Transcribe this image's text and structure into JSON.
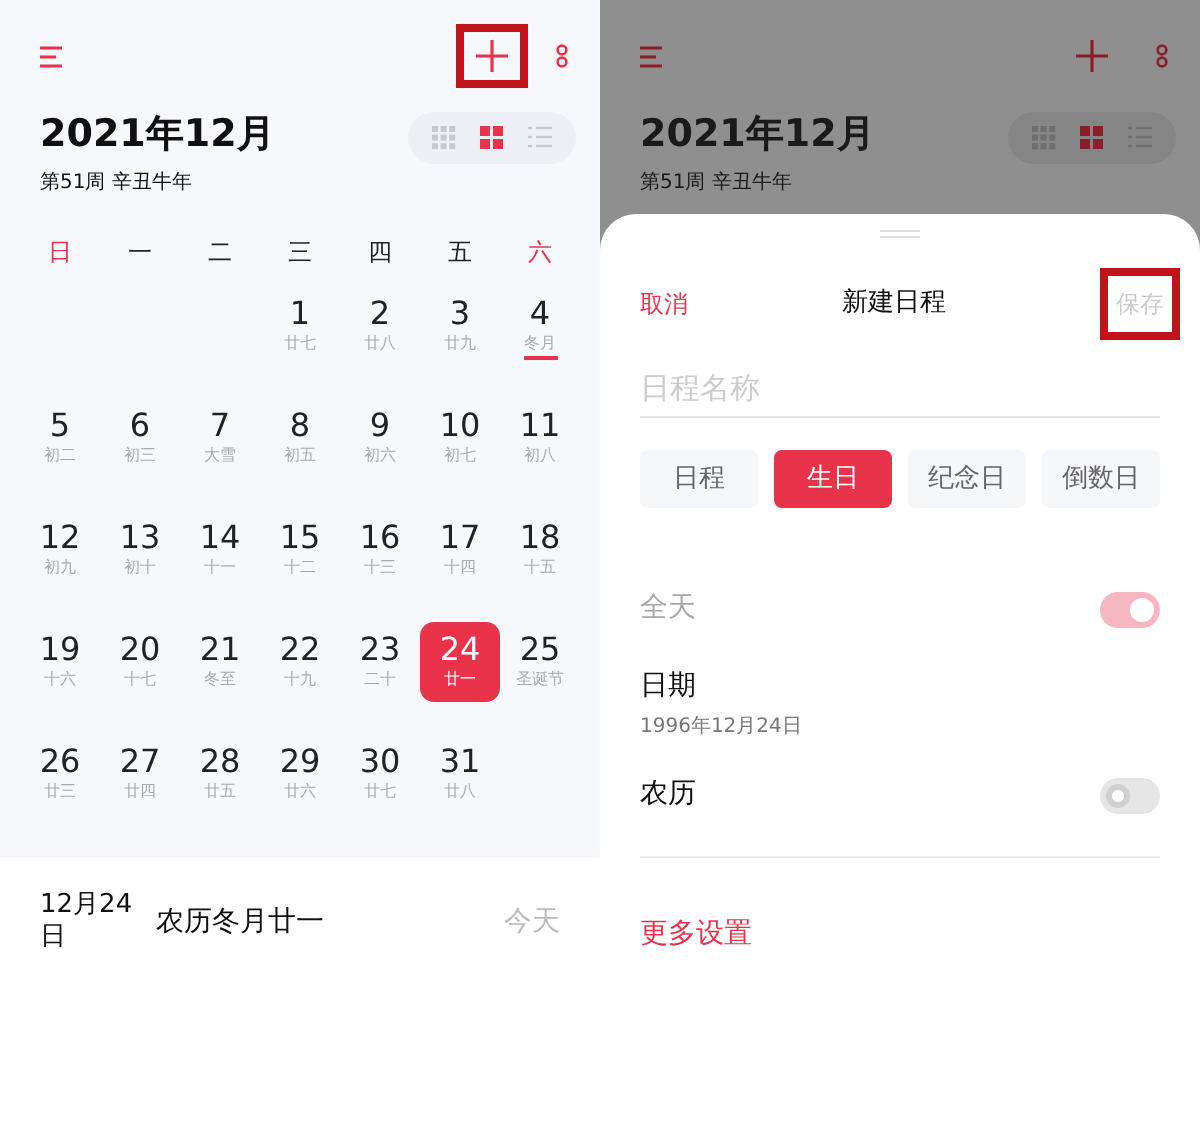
{
  "calendar": {
    "header": {
      "add_highlighted": true
    },
    "title": "2021年12月",
    "subtitle": "第51周 辛丑牛年",
    "view_modes": [
      {
        "kind": "grid9",
        "selected": false
      },
      {
        "kind": "grid4",
        "selected": true
      },
      {
        "kind": "list",
        "selected": false
      }
    ],
    "weekdays": [
      {
        "label": "日",
        "weekend": true
      },
      {
        "label": "一",
        "weekend": false
      },
      {
        "label": "二",
        "weekend": false
      },
      {
        "label": "三",
        "weekend": false
      },
      {
        "label": "四",
        "weekend": false
      },
      {
        "label": "五",
        "weekend": false
      },
      {
        "label": "六",
        "weekend": true
      }
    ],
    "weeks": [
      [
        {
          "day": "1",
          "lunar": "廿七",
          "selected": false,
          "marked": false
        },
        {
          "day": "2",
          "lunar": "廿八",
          "selected": false,
          "marked": false
        },
        {
          "day": "3",
          "lunar": "廿九",
          "selected": false,
          "marked": false
        },
        {
          "day": "4",
          "lunar": "冬月",
          "selected": false,
          "marked": true
        }
      ],
      [
        {
          "day": "5",
          "lunar": "初二",
          "selected": false,
          "marked": false
        },
        {
          "day": "6",
          "lunar": "初三",
          "selected": false,
          "marked": false
        },
        {
          "day": "7",
          "lunar": "大雪",
          "selected": false,
          "marked": false
        },
        {
          "day": "8",
          "lunar": "初五",
          "selected": false,
          "marked": false
        },
        {
          "day": "9",
          "lunar": "初六",
          "selected": false,
          "marked": false
        },
        {
          "day": "10",
          "lunar": "初七",
          "selected": false,
          "marked": false
        },
        {
          "day": "11",
          "lunar": "初八",
          "selected": false,
          "marked": false
        }
      ],
      [
        {
          "day": "12",
          "lunar": "初九",
          "selected": false,
          "marked": false
        },
        {
          "day": "13",
          "lunar": "初十",
          "selected": false,
          "marked": false
        },
        {
          "day": "14",
          "lunar": "十一",
          "selected": false,
          "marked": false
        },
        {
          "day": "15",
          "lunar": "十二",
          "selected": false,
          "marked": false
        },
        {
          "day": "16",
          "lunar": "十三",
          "selected": false,
          "marked": false
        },
        {
          "day": "17",
          "lunar": "十四",
          "selected": false,
          "marked": false
        },
        {
          "day": "18",
          "lunar": "十五",
          "selected": false,
          "marked": false
        }
      ],
      [
        {
          "day": "19",
          "lunar": "十六",
          "selected": false,
          "marked": false
        },
        {
          "day": "20",
          "lunar": "十七",
          "selected": false,
          "marked": false
        },
        {
          "day": "21",
          "lunar": "冬至",
          "selected": false,
          "marked": false
        },
        {
          "day": "22",
          "lunar": "十九",
          "selected": false,
          "marked": false
        },
        {
          "day": "23",
          "lunar": "二十",
          "selected": false,
          "marked": false
        },
        {
          "day": "24",
          "lunar": "廿一",
          "selected": true,
          "marked": false
        },
        {
          "day": "25",
          "lunar": "圣诞节",
          "selected": false,
          "marked": false
        }
      ],
      [
        {
          "day": "26",
          "lunar": "廿三",
          "selected": false,
          "marked": false
        },
        {
          "day": "27",
          "lunar": "廿四",
          "selected": false,
          "marked": false
        },
        {
          "day": "28",
          "lunar": "廿五",
          "selected": false,
          "marked": false
        },
        {
          "day": "29",
          "lunar": "廿六",
          "selected": false,
          "marked": false
        },
        {
          "day": "30",
          "lunar": "廿七",
          "selected": false,
          "marked": false
        },
        {
          "day": "31",
          "lunar": "廿八",
          "selected": false,
          "marked": false
        }
      ]
    ],
    "selected_day": {
      "date": "12月24日",
      "lunar": "农历冬月廿一",
      "today": "今天"
    }
  },
  "dimmed_background": {
    "title": "2021年12月",
    "subtitle": "第51周 辛丑牛年"
  },
  "new_event_sheet": {
    "cancel": "取消",
    "title": "新建日程",
    "save": {
      "label": "保存",
      "highlighted": true
    },
    "name_field": {
      "placeholder": "日程名称"
    },
    "types": [
      {
        "label": "日程",
        "selected": false
      },
      {
        "label": "生日",
        "selected": true
      },
      {
        "label": "纪念日",
        "selected": false
      },
      {
        "label": "倒数日",
        "selected": false
      }
    ],
    "all_day": {
      "label": "全天",
      "on": true,
      "disabled": true
    },
    "date": {
      "label": "日期",
      "value": "1996年12月24日"
    },
    "lunar": {
      "label": "农历",
      "on": false
    },
    "more": "更多设置"
  }
}
